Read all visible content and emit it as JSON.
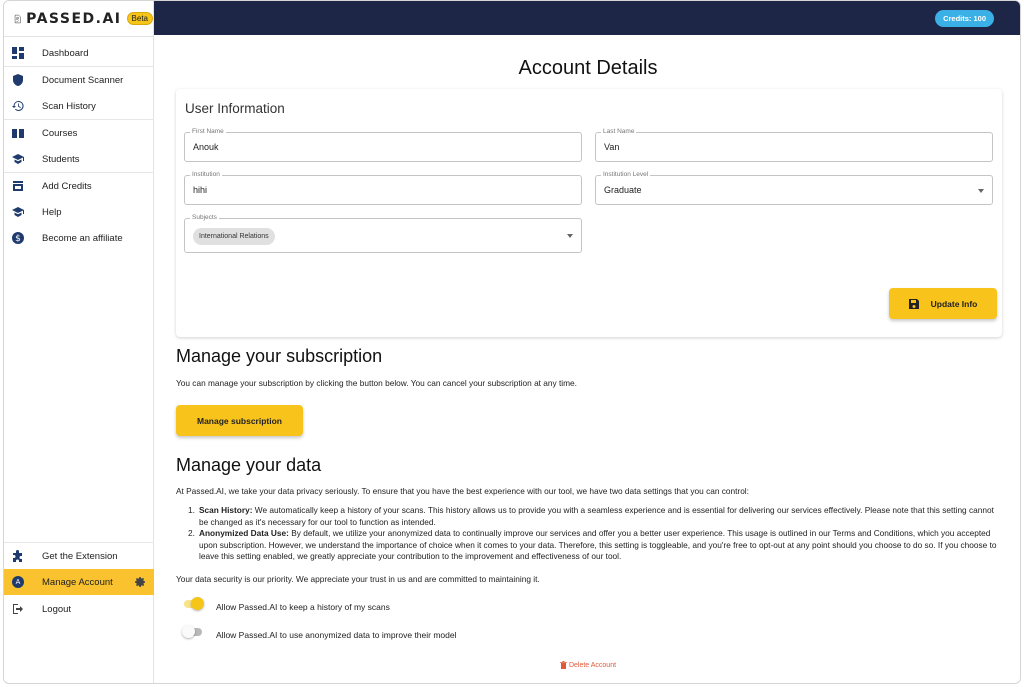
{
  "brand": {
    "name": "PASSED.AI",
    "badge": "Beta"
  },
  "topbar": {
    "credits": "Credits: 100"
  },
  "sidebar": {
    "items": [
      {
        "label": "Dashboard",
        "icon": "dashboard-icon"
      },
      {
        "label": "Document Scanner",
        "icon": "shield-icon"
      },
      {
        "label": "Scan History",
        "icon": "history-icon"
      },
      {
        "label": "Courses",
        "icon": "book-icon"
      },
      {
        "label": "Students",
        "icon": "graduation-cap-icon"
      },
      {
        "label": "Add Credits",
        "icon": "store-icon"
      },
      {
        "label": "Help",
        "icon": "graduation-cap-icon"
      },
      {
        "label": "Become an affiliate",
        "icon": "dollar-icon"
      }
    ],
    "bottom": [
      {
        "label": "Get the Extension",
        "icon": "puzzle-icon"
      },
      {
        "label": "Manage Account",
        "icon": "avatar-icon",
        "avatar_letter": "A"
      },
      {
        "label": "Logout",
        "icon": "logout-icon"
      }
    ]
  },
  "page": {
    "title": "Account Details"
  },
  "user_info": {
    "title": "User Information",
    "first_name": {
      "label": "First Name",
      "value": "Anouk"
    },
    "last_name": {
      "label": "Last Name",
      "value": "Van"
    },
    "institution": {
      "label": "Institution",
      "value": "hihi"
    },
    "institution_level": {
      "label": "Institution Level",
      "value": "Graduate"
    },
    "subjects": {
      "label": "Subjects",
      "chip": "International Relations"
    },
    "update_button": "Update Info"
  },
  "subscription": {
    "title": "Manage your subscription",
    "text": "You can manage your subscription by clicking the button below. You can cancel your subscription at any time.",
    "button": "Manage subscription"
  },
  "data_section": {
    "title": "Manage your data",
    "intro": "At Passed.AI, we take your data privacy seriously. To ensure that you have the best experience with our tool, we have two data settings that you can control:",
    "items": [
      {
        "num": "1.",
        "term": "Scan History:",
        "text": " We automatically keep a history of your scans. This history allows us to provide you with a seamless experience and is essential for delivering our services effectively. Please note that this setting cannot be changed as it's necessary for our tool to function as intended."
      },
      {
        "num": "2.",
        "term": "Anonymized Data Use:",
        "text": " By default, we utilize your anonymized data to continually improve our services and offer you a better user experience. This usage is outlined in our Terms and Conditions, which you accepted upon subscription. However, we understand the importance of choice when it comes to your data. Therefore, this setting is toggleable, and you're free to opt-out at any point should you choose to do so. If you choose to leave this setting enabled, we greatly appreciate your contribution to the improvement and effectiveness of our tool."
      }
    ],
    "closing": "Your data security is our priority. We appreciate your trust in us and are committed to maintaining it.",
    "toggles": [
      {
        "label": "Allow Passed.AI to keep a history of my scans",
        "checked": true
      },
      {
        "label": "Allow Passed.AI to use anonymized data to improve their model",
        "checked": false
      }
    ]
  },
  "delete_account": "Delete Account",
  "colors": {
    "accent": "#f8c31b",
    "topbar": "#1e2647",
    "credits": "#3ab0e6",
    "danger": "#e05a3a"
  }
}
